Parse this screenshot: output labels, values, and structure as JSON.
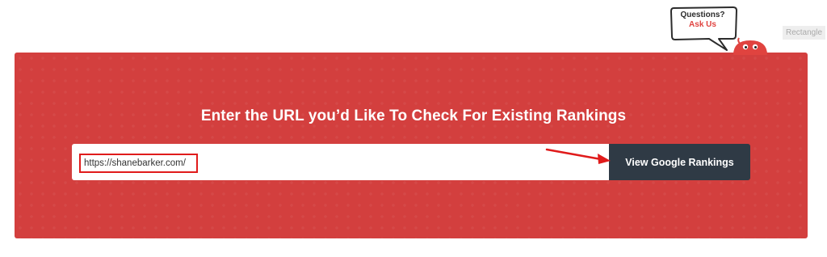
{
  "help_widget": {
    "line1": "Questions?",
    "line2": "Ask Us",
    "accent_color": "#e0433f"
  },
  "tooltip": {
    "label": "Rectangle"
  },
  "panel": {
    "background_color": "#d33f3e",
    "headline": "Enter the URL you’d Like To Check For Existing Rankings",
    "url_input": {
      "value": "https://shanebarker.com/",
      "highlight_color": "#e01b1b"
    },
    "submit_label": "View Google Rankings",
    "submit_color": "#2f3a45"
  },
  "annotation": {
    "icon": "red-arrow-right-icon",
    "color": "#e01b1b"
  }
}
